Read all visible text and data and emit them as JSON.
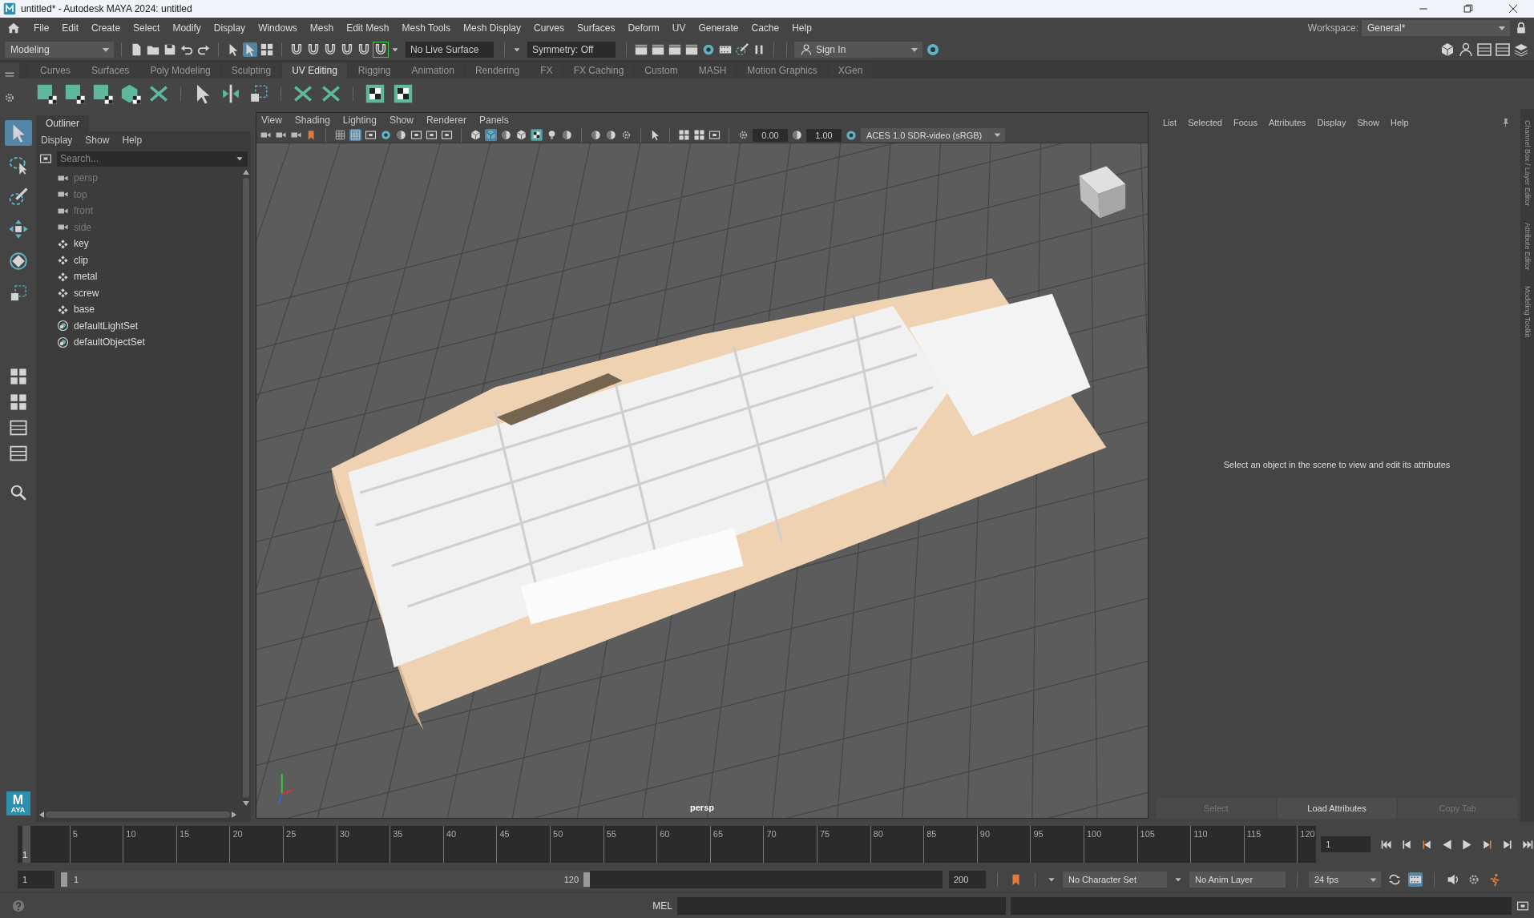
{
  "window": {
    "title": "untitled* - Autodesk MAYA 2024: untitled"
  },
  "menu_bar": {
    "items": [
      "File",
      "Edit",
      "Create",
      "Select",
      "Modify",
      "Display",
      "Windows",
      "Mesh",
      "Edit Mesh",
      "Mesh Tools",
      "Mesh Display",
      "Curves",
      "Surfaces",
      "Deform",
      "UV",
      "Generate",
      "Cache",
      "Help"
    ],
    "workspace_label": "Workspace:",
    "workspace": "General*"
  },
  "status_line": {
    "mode": "Modeling",
    "live_surface": "No Live Surface",
    "symmetry": "Symmetry: Off",
    "sign_in": "Sign In"
  },
  "shelf": {
    "tabs": [
      {
        "label": "Curves",
        "selected": false
      },
      {
        "label": "Surfaces",
        "selected": false
      },
      {
        "label": "Poly Modeling",
        "selected": false
      },
      {
        "label": "Sculpting",
        "selected": false
      },
      {
        "label": "UV Editing",
        "selected": true
      },
      {
        "label": "Rigging",
        "selected": false
      },
      {
        "label": "Animation",
        "selected": false
      },
      {
        "label": "Rendering",
        "selected": false
      },
      {
        "label": "FX",
        "selected": false
      },
      {
        "label": "FX Caching",
        "selected": false
      },
      {
        "label": "Custom",
        "selected": false
      },
      {
        "label": "MASH",
        "selected": false
      },
      {
        "label": "Motion Graphics",
        "selected": false
      },
      {
        "label": "XGen",
        "selected": false
      }
    ]
  },
  "toolbox": {
    "tools": [
      {
        "selected": true
      },
      {
        "selected": false
      },
      {
        "selected": false
      },
      {
        "selected": false
      },
      {
        "selected": false
      },
      {
        "selected": false
      }
    ],
    "logo": {
      "letter": "M",
      "subtext": "AYA"
    }
  },
  "outliner": {
    "title": "Outliner",
    "menus": [
      "Display",
      "Show",
      "Help"
    ],
    "search_placeholder": "Search...",
    "items": [
      {
        "label": "persp",
        "kind": "camera",
        "dimmed": true
      },
      {
        "label": "top",
        "kind": "camera",
        "dimmed": true
      },
      {
        "label": "front",
        "kind": "camera",
        "dimmed": true
      },
      {
        "label": "side",
        "kind": "camera",
        "dimmed": true
      },
      {
        "label": "key",
        "kind": "mesh",
        "dimmed": false
      },
      {
        "label": "clip",
        "kind": "mesh",
        "dimmed": false
      },
      {
        "label": "metal",
        "kind": "mesh",
        "dimmed": false
      },
      {
        "label": "screw",
        "kind": "mesh",
        "dimmed": false
      },
      {
        "label": "base",
        "kind": "mesh",
        "dimmed": false
      },
      {
        "label": "defaultLightSet",
        "kind": "set",
        "dimmed": false
      },
      {
        "label": "defaultObjectSet",
        "kind": "set",
        "dimmed": false
      }
    ]
  },
  "viewport": {
    "menus": [
      "View",
      "Shading",
      "Lighting",
      "Show",
      "Renderer",
      "Panels"
    ],
    "exposure": "0.00",
    "gamma": "1.00",
    "color_space": "ACES 1.0 SDR-video (sRGB)",
    "camera_label": "persp"
  },
  "attribute_editor": {
    "menus": [
      "List",
      "Selected",
      "Focus",
      "Attributes",
      "Display",
      "Show",
      "Help"
    ],
    "message": "Select an object in the scene to view and edit its attributes",
    "buttons": [
      {
        "label": "Select",
        "disabled": true
      },
      {
        "label": "Load Attributes",
        "disabled": false
      },
      {
        "label": "Copy Tab",
        "disabled": true
      }
    ]
  },
  "side_tabs": [
    "Channel Box / Layer Editor",
    "Attribute Editor",
    "Modeling Toolkit"
  ],
  "timeline": {
    "start_label": "1",
    "ticks": [
      "5",
      "10",
      "15",
      "20",
      "25",
      "30",
      "35",
      "40",
      "45",
      "50",
      "55",
      "60",
      "65",
      "70",
      "75",
      "80",
      "85",
      "90",
      "95",
      "100",
      "105",
      "110",
      "115",
      "120"
    ],
    "current_frame": "1"
  },
  "range_slider": {
    "start": "1",
    "range_start": "1",
    "range_end": "120",
    "end": "200",
    "level": 0.6
  },
  "anim_controls": {
    "character_set": "No Character Set",
    "anim_layer": "No Anim Layer",
    "fps": "24 fps"
  },
  "command_line": {
    "language": "MEL"
  }
}
